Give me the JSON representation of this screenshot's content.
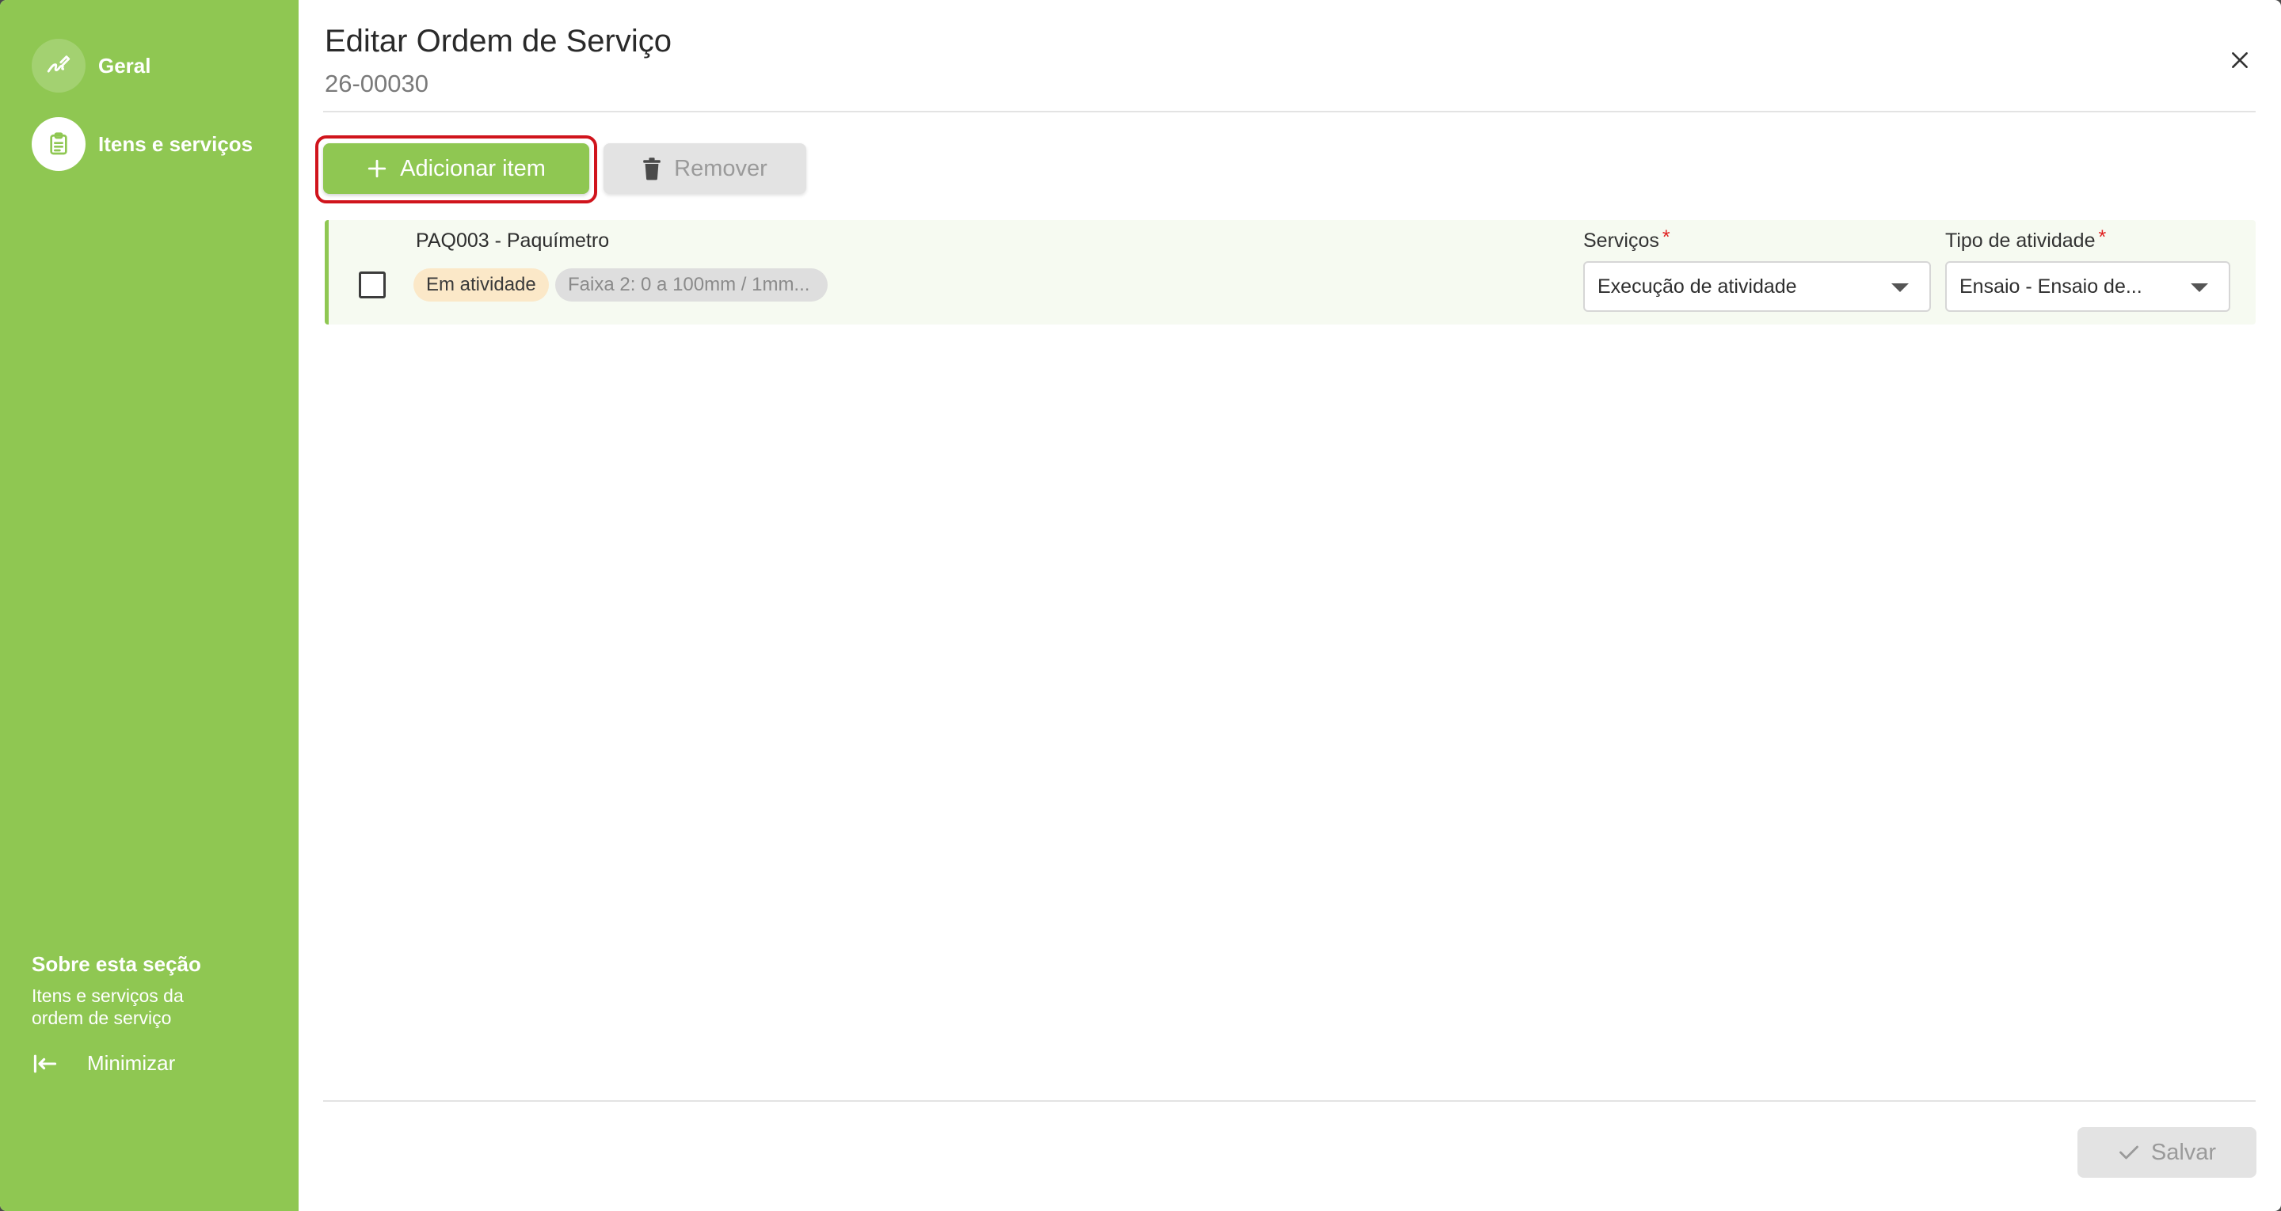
{
  "dialog": {
    "title": "Editar Ordem de Serviço",
    "subtitle": "26-00030"
  },
  "sidebar": {
    "items": [
      {
        "label": "Geral",
        "icon": "signature-icon",
        "active": false
      },
      {
        "label": "Itens e serviços",
        "icon": "clipboard-list-icon",
        "active": true
      }
    ],
    "about_title": "Sobre esta seção",
    "about_desc": "Itens e serviços da ordem de serviço",
    "minimize_label": "Minimizar",
    "color": "#8fc752"
  },
  "toolbar": {
    "add_label": "Adicionar item",
    "remove_label": "Remover"
  },
  "items": [
    {
      "name": "PAQ003 - Paquímetro",
      "status": "Em atividade",
      "range": "Faixa 2: 0 a 100mm / 1mm...",
      "servicos_label": "Serviços",
      "servicos_value": "Execução de atividade",
      "tipo_label": "Tipo de atividade",
      "tipo_value": "Ensaio - Ensaio de...",
      "required_mark": "*"
    }
  ],
  "footer": {
    "save_label": "Salvar"
  }
}
